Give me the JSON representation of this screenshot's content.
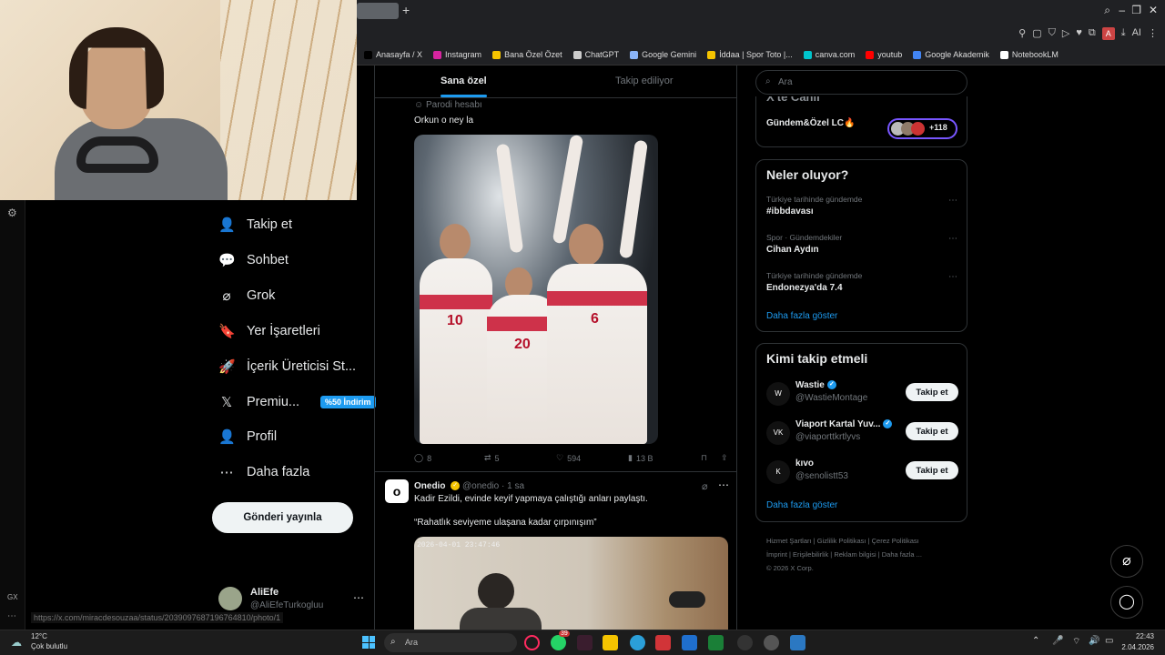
{
  "browser": {
    "bookmarks": [
      {
        "label": "Anasayfa / X",
        "color": "#000000"
      },
      {
        "label": "Instagram",
        "color": "#d6249f"
      },
      {
        "label": "Bana Özel Özet",
        "color": "#f5c400"
      },
      {
        "label": "ChatGPT",
        "color": "#cccccc"
      },
      {
        "label": "Google Gemini",
        "color": "#8ab4f8"
      },
      {
        "label": "İddaa | Spor Toto |...",
        "color": "#f5c400"
      },
      {
        "label": "canva.com",
        "color": "#00c4cc"
      },
      {
        "label": "youtub",
        "color": "#ff0000"
      },
      {
        "label": "Google Akademik",
        "color": "#4285f4"
      },
      {
        "label": "NotebookLM",
        "color": "#ffffff"
      }
    ],
    "toolbar_ai": "AI",
    "toolbar_a": "A"
  },
  "sidebar": {
    "items": [
      {
        "label": "Takip et",
        "icon": "add-user-icon",
        "glyph": "👤"
      },
      {
        "label": "Sohbet",
        "icon": "chat-icon",
        "glyph": "💬"
      },
      {
        "label": "Grok",
        "icon": "grok-icon",
        "glyph": "⌀"
      },
      {
        "label": "Yer İşaretleri",
        "icon": "bookmark-icon",
        "glyph": "🔖"
      },
      {
        "label": "İçerik Üreticisi St...",
        "icon": "rocket-icon",
        "glyph": "🚀"
      },
      {
        "label": "Premiu...",
        "icon": "x-logo-icon",
        "glyph": "𝕏",
        "badge": "%50 İndirim"
      },
      {
        "label": "Profil",
        "icon": "profile-icon",
        "glyph": "👤"
      },
      {
        "label": "Daha fazla",
        "icon": "more-circle-icon",
        "glyph": "⋯"
      }
    ],
    "post_button": "Gönderi yayınla",
    "user": {
      "name": "AliEfe",
      "handle": "@AliEfeTurkogluu"
    },
    "status_url": "https://x.com/miracdesouzaa/status/2039097687196764810/photo/1",
    "gx_label": "GX"
  },
  "feed": {
    "tabs": [
      "Sana özel",
      "Takip ediliyor"
    ],
    "tweet1": {
      "parody_label": "Parodi hesabı",
      "text": "Orkun o ney la",
      "jersey_numbers": [
        "10",
        "20",
        "6"
      ],
      "stats": {
        "replies": "8",
        "reposts": "5",
        "likes": "594",
        "views": "13 B"
      }
    },
    "tweet2": {
      "name": "Onedio",
      "handle": "@onedio",
      "time": "1 sa",
      "text1": "Kadir Ezildi, evinde keyif yapmaya çalıştığı anları paylaştı.",
      "text2": "“Rahatlık seviyeme ulaşana kadar çırpınışım”",
      "cam_timestamp": "2026-04-01 23:47:46"
    }
  },
  "right": {
    "search_placeholder": "Ara",
    "community": {
      "header": "X'te Canlı",
      "name": "Gündem&Özel LC🔥",
      "count": "+118"
    },
    "trends": {
      "title": "Neler oluyor?",
      "items": [
        {
          "context": "Türkiye tarihinde gündemde",
          "name": "#ibbdavası"
        },
        {
          "context": "Spor · Gündemdekiler",
          "name": "Cihan Aydın"
        },
        {
          "context": "Türkiye tarihinde gündemde",
          "name": "Endonezya'da 7.4"
        }
      ],
      "show_more": "Daha fazla göster"
    },
    "who_to_follow": {
      "title": "Kimi takip etmeli",
      "items": [
        {
          "name": "Wastie",
          "handle": "@WastieMontage",
          "button": "Takip et",
          "avatar": "W"
        },
        {
          "name": "Viaport Kartal Yuv...",
          "handle": "@viaporttkrtlyvs",
          "button": "Takip et",
          "avatar": "VK"
        },
        {
          "name": "kıvo",
          "handle": "@senolistt53",
          "button": "Takip et",
          "avatar": "K"
        }
      ],
      "show_more": "Daha fazla göster"
    },
    "footer": [
      "Hizmet Şartları",
      "Gizlilik Politikası",
      "Çerez Politikası",
      "İmprint",
      "Erişilebilirlik",
      "Reklam bilgisi",
      "Daha fazla ...",
      "© 2026 X Corp."
    ]
  },
  "taskbar": {
    "temp": "12°C",
    "condition": "Çok bulutlu",
    "search_placeholder": "Ara",
    "badge": "39",
    "time": "22:43",
    "date": "2.04.2026"
  }
}
